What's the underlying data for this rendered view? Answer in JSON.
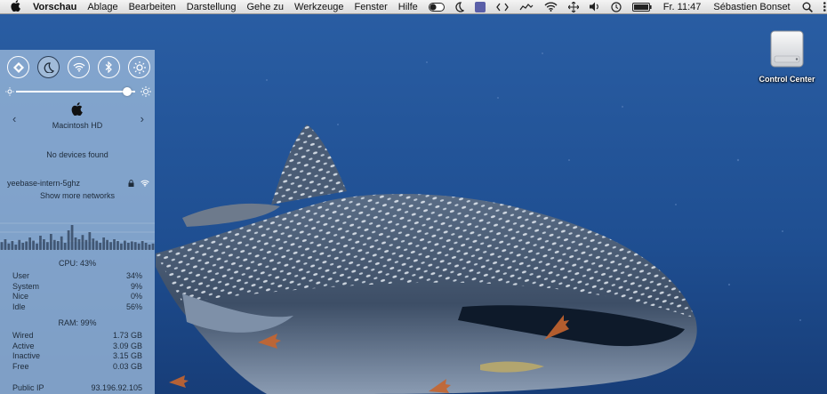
{
  "menubar": {
    "app_name": "Vorschau",
    "menus": [
      "Ablage",
      "Bearbeiten",
      "Darstellung",
      "Gehe zu",
      "Werkzeuge",
      "Fenster",
      "Hilfe"
    ],
    "clock": "Fr. 11:47",
    "user": "Sébastien Bonset"
  },
  "control_center": {
    "brightness_level": 0.93,
    "disk_name": "Macintosh HD",
    "devices_text": "No devices found",
    "network_name": "yeebase-intern-5ghz",
    "show_more_networks": "Show more networks",
    "cpu": {
      "heading": "CPU: 43%",
      "rows": [
        {
          "label": "User",
          "value": "34%"
        },
        {
          "label": "System",
          "value": "9%"
        },
        {
          "label": "Nice",
          "value": "0%"
        },
        {
          "label": "Idle",
          "value": "56%"
        }
      ],
      "history": [
        22,
        30,
        18,
        25,
        15,
        28,
        20,
        24,
        35,
        26,
        18,
        40,
        30,
        22,
        45,
        28,
        25,
        38,
        20,
        55,
        70,
        35,
        30,
        42,
        28,
        50,
        32,
        26,
        20,
        35,
        28,
        22,
        30,
        25,
        18,
        26,
        20,
        24,
        22,
        18,
        25,
        20,
        15,
        18
      ]
    },
    "ram": {
      "heading": "RAM: 99%",
      "rows": [
        {
          "label": "Wired",
          "value": "1.73 GB"
        },
        {
          "label": "Active",
          "value": "3.09 GB"
        },
        {
          "label": "Inactive",
          "value": "3.15 GB"
        },
        {
          "label": "Free",
          "value": "0.03 GB"
        }
      ]
    },
    "public_ip": {
      "label": "Public IP",
      "value": "93.196.92.105"
    }
  },
  "desktop": {
    "icon_label": "Control Center"
  },
  "colors": {
    "water_top": "#234f8f",
    "water_bottom": "#173b73",
    "panel": "#96b4d7",
    "menubar": "#e8e8e8"
  }
}
